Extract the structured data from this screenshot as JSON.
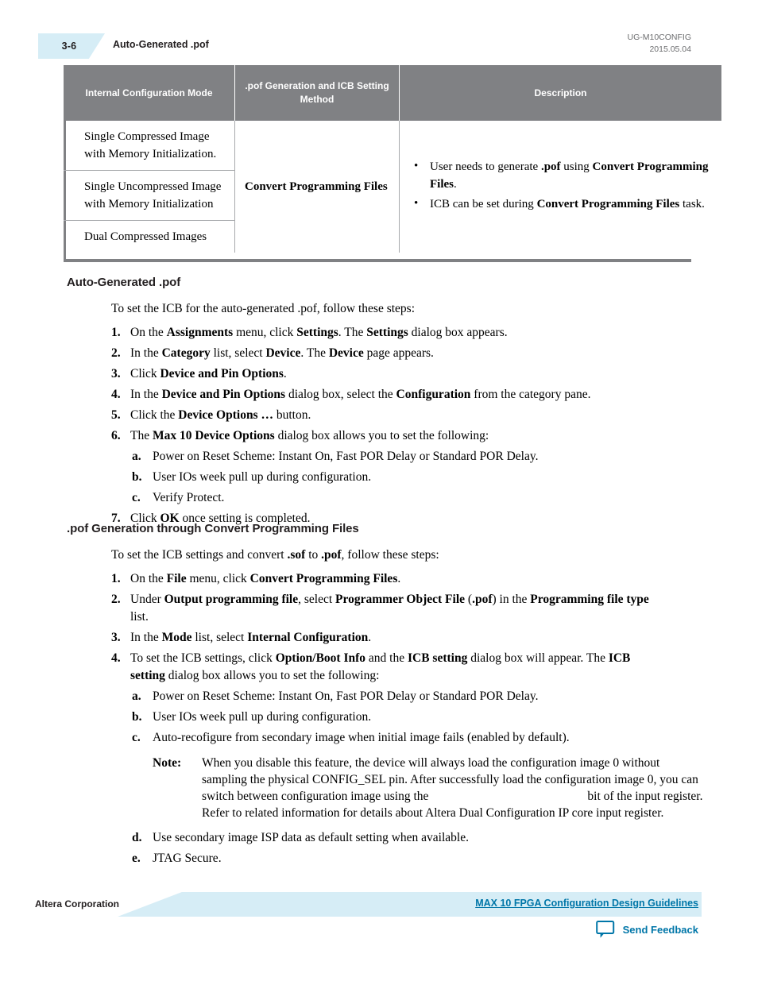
{
  "header": {
    "page_number": "3-6",
    "running_title": "Auto-Generated .pof",
    "doc_id": "UG-M10CONFIG",
    "doc_date": "2015.05.04"
  },
  "table": {
    "columns": [
      "Internal Configuration Mode",
      ".pof Generation and ICB Setting Method",
      "Description"
    ],
    "modes": [
      "Single Compressed Image with Memory Initialization.",
      "Single Uncompressed Image with Memory Initialization",
      "Dual Compressed Images"
    ],
    "method": "Convert Programming Files",
    "description_bullets": [
      "User needs to generate .pof using Convert Programming Files.",
      "ICB can be set during Convert Programming Files task."
    ]
  },
  "section1": {
    "heading": "Auto-Generated .pof",
    "intro": "To set the ICB for the auto-generated .pof, follow these steps:",
    "steps": [
      {
        "marker": "1.",
        "text": "On the Assignments menu, click Settings. The Settings dialog box appears."
      },
      {
        "marker": "2.",
        "text": "In the Category list, select Device. The Device page appears."
      },
      {
        "marker": "3.",
        "text": "Click Device and Pin Options."
      },
      {
        "marker": "4.",
        "text": "In the Device and Pin Options dialog box, select the Configuration from the category pane."
      },
      {
        "marker": "5.",
        "text": "Click the Device Options … button."
      },
      {
        "marker": "6.",
        "text": "The Max 10 Device Options dialog box allows you to set the following:"
      }
    ],
    "substeps": [
      {
        "marker": "a.",
        "text": "Power on Reset Scheme: Instant On, Fast POR Delay or Standard POR Delay."
      },
      {
        "marker": "b.",
        "text": "User IOs week pull up during configuration."
      },
      {
        "marker": "c.",
        "text": "Verify Protect."
      }
    ],
    "final_step": {
      "marker": "7.",
      "text": "Click OK once setting is completed."
    }
  },
  "section2": {
    "heading": ".pof Generation through Convert Programming Files",
    "intro": "To set the ICB settings and convert .sof to .pof, follow these steps:",
    "steps": [
      {
        "marker": "1.",
        "text": "On the File menu, click Convert Programming Files."
      },
      {
        "marker": "2.",
        "text": "Under Output programming file, select Programmer Object File (.pof) in the Programming file type list."
      },
      {
        "marker": "3.",
        "text": "In the Mode list, select Internal Configuration."
      },
      {
        "marker": "4.",
        "text": "To set the ICB settings, click Option/Boot Info and the ICB setting dialog box will appear. The ICB setting dialog box allows you to set the following:"
      }
    ],
    "substeps": [
      {
        "marker": "a.",
        "text": "Power on Reset Scheme: Instant On, Fast POR Delay or Standard POR Delay."
      },
      {
        "marker": "b.",
        "text": "User IOs week pull up during configuration."
      },
      {
        "marker": "c.",
        "text": "Auto-recofigure from secondary image when initial image fails (enabled by default)."
      }
    ],
    "note": {
      "label": "Note:",
      "line1": "When you disable this feature, the device will always load the configuration image 0 without",
      "line2": "sampling the physical CONFIG_SEL pin. After successfully load the configuration image 0,",
      "line3_a": "you can switch between configuration image using the",
      "line3_b": "bit of the",
      "line4": "input register. Refer to related information for details about Altera Dual Configuration IP",
      "line5": "core input register."
    },
    "substeps_tail": [
      {
        "marker": "d.",
        "text": "Use secondary image ISP data as default setting when available."
      },
      {
        "marker": "e.",
        "text": "JTAG Secure."
      }
    ]
  },
  "footer": {
    "corporation": "Altera Corporation",
    "doc_link": "MAX 10 FPGA Configuration Design Guidelines",
    "feedback_label": "Send Feedback"
  },
  "colors": {
    "tab_blue": "#d6edf6",
    "link_blue": "#0076a8",
    "table_header_gray": "#808184",
    "rule_gray": "#a7a9ac"
  }
}
